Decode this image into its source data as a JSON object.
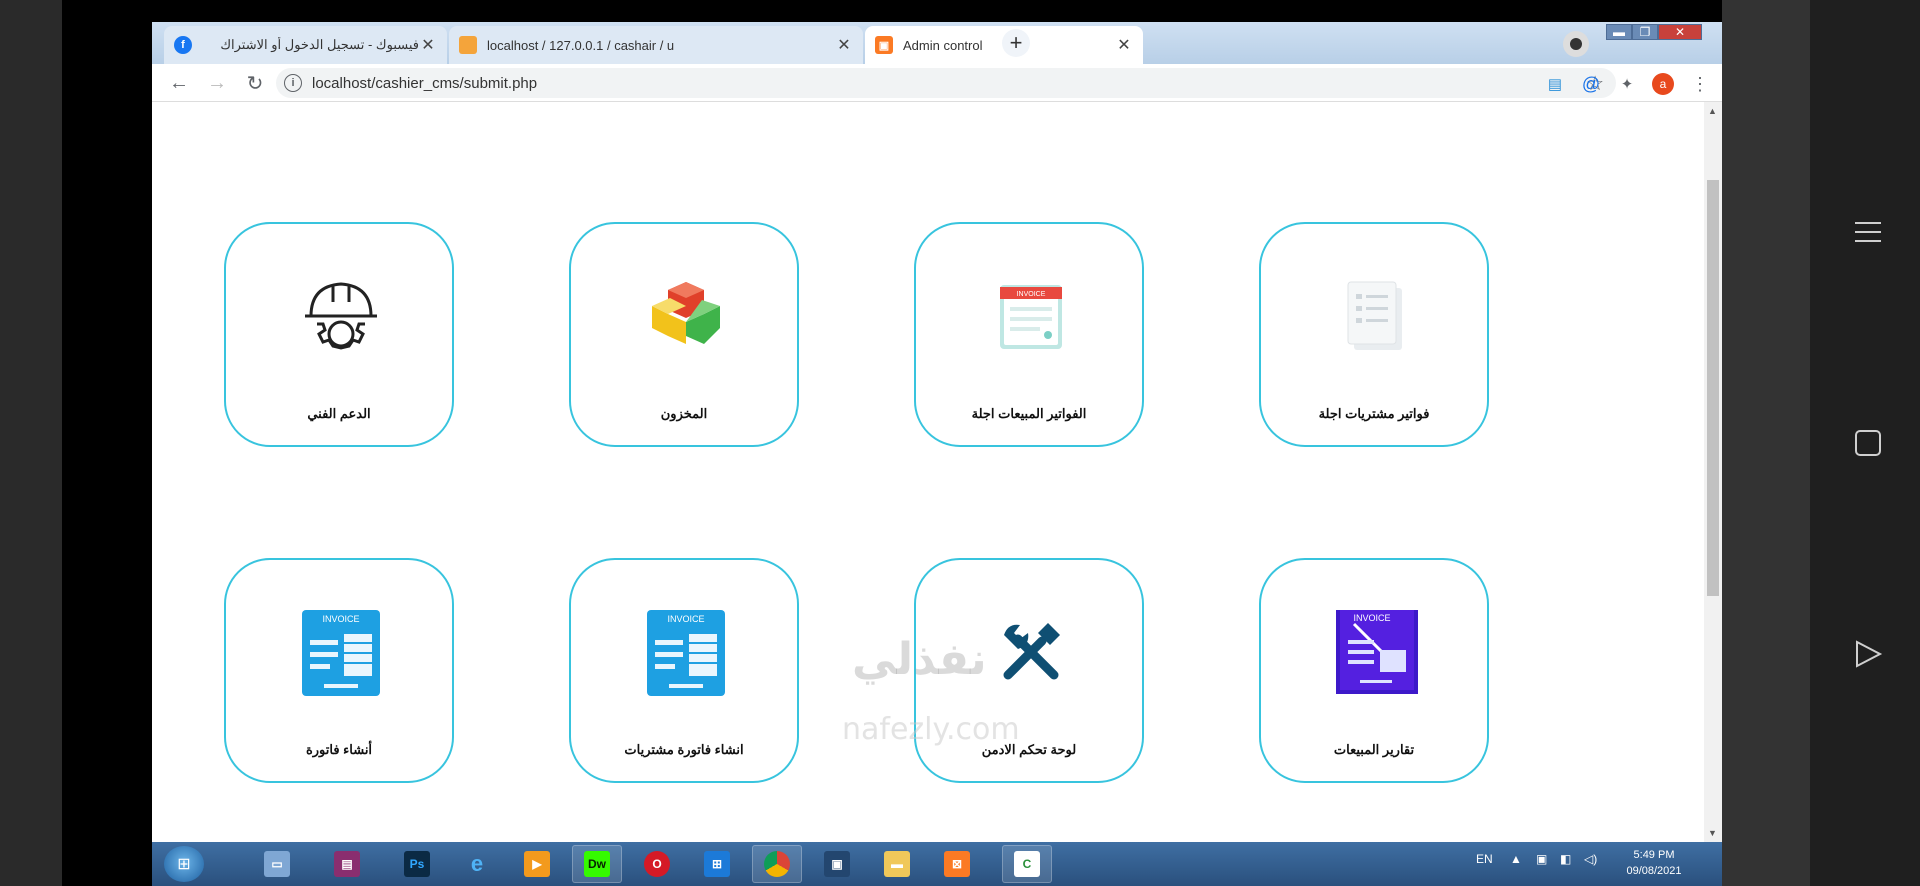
{
  "browser": {
    "tabs": [
      {
        "title": "فيسبوك - تسجيل الدخول أو الاشتراك",
        "favicon": "facebook-icon"
      },
      {
        "title": "localhost / 127.0.0.1 / cashair / u",
        "favicon": "phpmyadmin-icon"
      },
      {
        "title": "Admin control",
        "favicon": "xampp-icon"
      }
    ],
    "new_tab": "+",
    "url": "localhost/cashier_cms/submit.php",
    "avatar_letter": "a",
    "window_controls": {
      "minimize": "▬",
      "maximize": "❐",
      "close": "✕"
    }
  },
  "tiles": [
    {
      "label": "فواتير مشتريات اجلة",
      "icon": "document-stack-icon"
    },
    {
      "label": "الفواتير المبيعات اجلة",
      "icon": "invoice-red-icon"
    },
    {
      "label": "المخزون",
      "icon": "cubes-icon"
    },
    {
      "label": "الدعم الفني",
      "icon": "helmet-gear-icon"
    },
    {
      "label": "تقارير المبيعات",
      "icon": "invoice-purple-icon"
    },
    {
      "label": "لوحة تحكم الادمن",
      "icon": "tools-icon"
    },
    {
      "label": "انشاء فاتورة مشتريات",
      "icon": "invoice-blue-icon"
    },
    {
      "label": "أنشاء فاتورة",
      "icon": "invoice-blue-icon"
    }
  ],
  "invoice_text": "INVOICE",
  "taskbar": {
    "apps": [
      "Ps",
      "Dw",
      "Opera",
      "Chrome",
      "XAMPP"
    ],
    "language": "EN",
    "time": "5:49 PM",
    "date": "09/08/2021"
  },
  "watermark": {
    "text_ar": "نفذلي",
    "text_en": "nafezly.com"
  },
  "colors": {
    "tile_border": "#38c4de",
    "taskbar": "#2a507d"
  }
}
